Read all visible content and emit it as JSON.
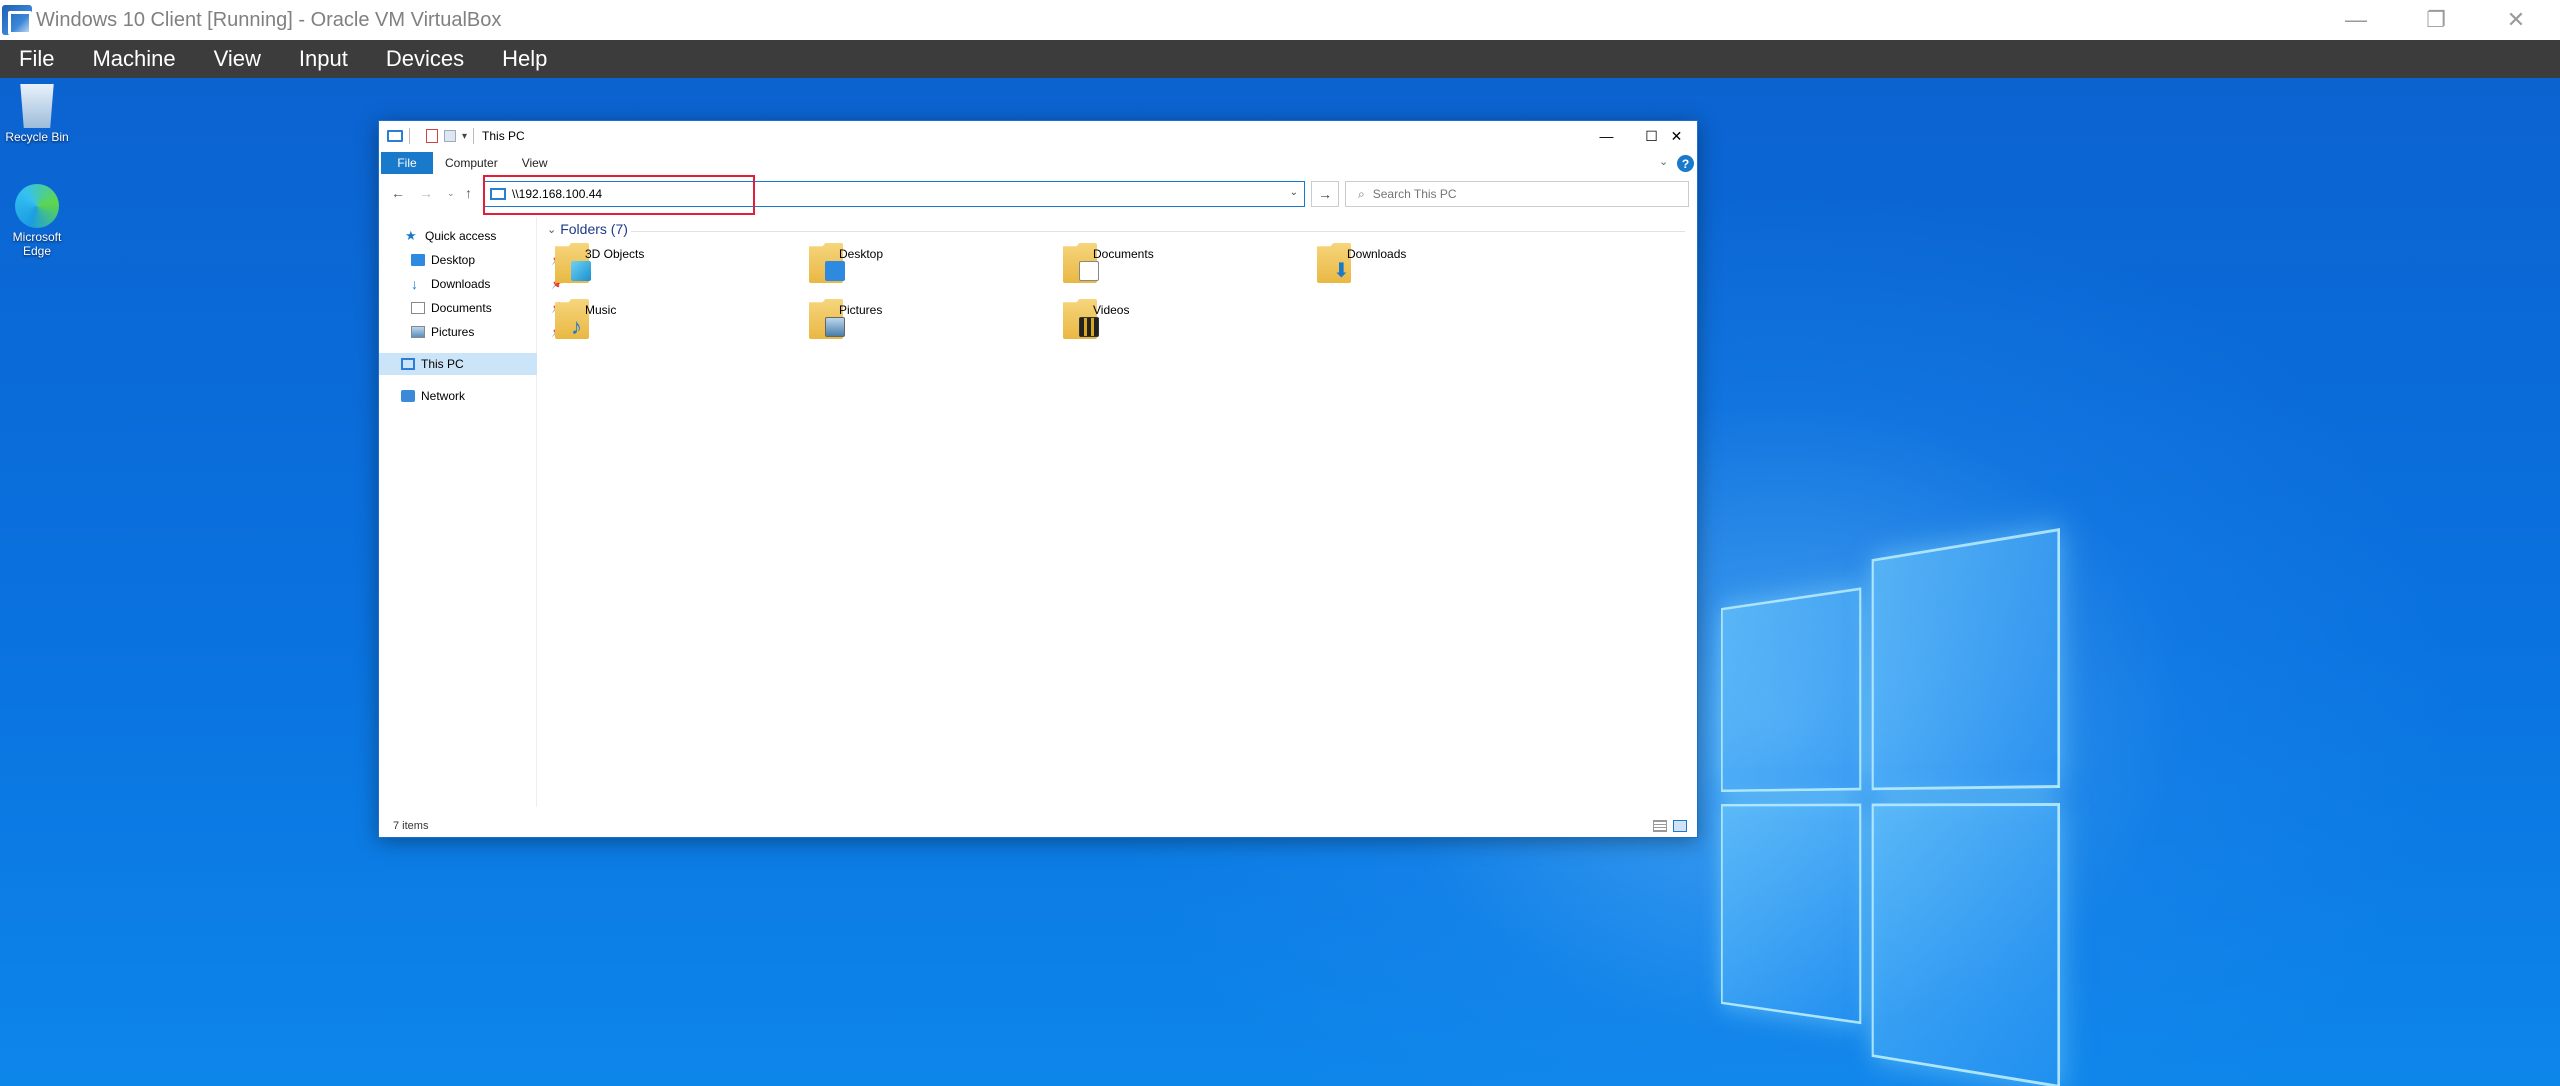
{
  "host_window": {
    "title": "Windows 10 Client [Running] - Oracle VM VirtualBox",
    "menu": [
      "File",
      "Machine",
      "View",
      "Input",
      "Devices",
      "Help"
    ],
    "controls": {
      "minimize": "—",
      "restore": "❐",
      "close": "✕"
    }
  },
  "desktop": {
    "icons": [
      {
        "label": "Recycle Bin",
        "icon": "recycle-bin-icon"
      },
      {
        "label": "Microsoft Edge",
        "icon": "edge-icon"
      }
    ]
  },
  "explorer": {
    "title": "This PC",
    "controls": {
      "minimize": "—",
      "maximize": "☐",
      "close": "✕"
    },
    "ribbon_tabs": [
      "File",
      "Computer",
      "View"
    ],
    "help_label": "?",
    "nav_buttons": {
      "back": "←",
      "forward": "→",
      "recent": "⌄",
      "up": "↑",
      "go": "→"
    },
    "address_value": "\\\\192.168.100.44",
    "search_placeholder": "Search This PC",
    "nav_pane": {
      "quick_access": "Quick access",
      "pinned": [
        "Desktop",
        "Downloads",
        "Documents",
        "Pictures"
      ],
      "this_pc": "This PC",
      "network": "Network"
    },
    "folders_header": "Folders (7)",
    "folders": [
      "3D Objects",
      "Desktop",
      "Documents",
      "Downloads",
      "Music",
      "Pictures",
      "Videos"
    ],
    "status": "7 items"
  },
  "colors": {
    "accent": "#1979ca",
    "highlight_box": "#e0203a",
    "menubar": "#3c3c3c"
  }
}
